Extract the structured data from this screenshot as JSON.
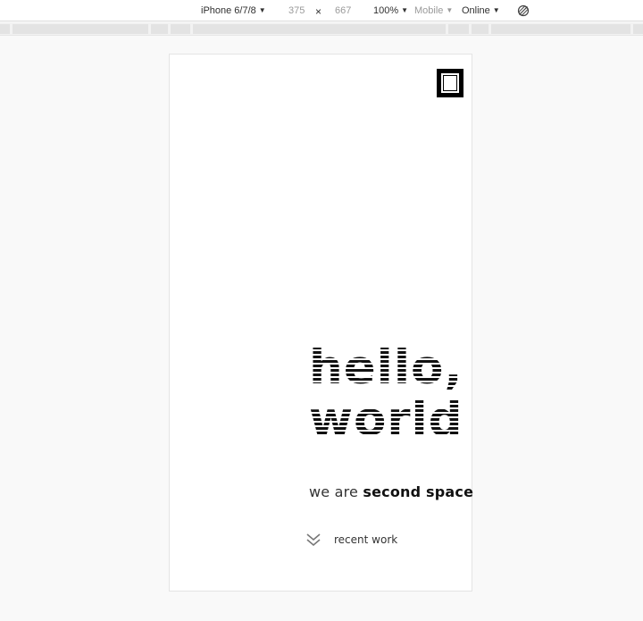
{
  "toolbar": {
    "device_name": "iPhone 6/7/8",
    "width_value": "375",
    "times_sign": "×",
    "height_value": "667",
    "zoom": "100%",
    "device_type": "Mobile",
    "throttling": "Online",
    "rotate_icon": "rotate-icon"
  },
  "page": {
    "menu_icon": "square-menu-icon",
    "title_line1": "hello,",
    "title_line2": "world",
    "tagline_prefix": "we are ",
    "tagline_emphasis": "second space",
    "recent_icon": "double-chevron-down-icon",
    "recent_label": "recent work"
  },
  "colors": {
    "page_background": "#f9f9f9",
    "device_background": "#ffffff",
    "text": "#111111"
  }
}
